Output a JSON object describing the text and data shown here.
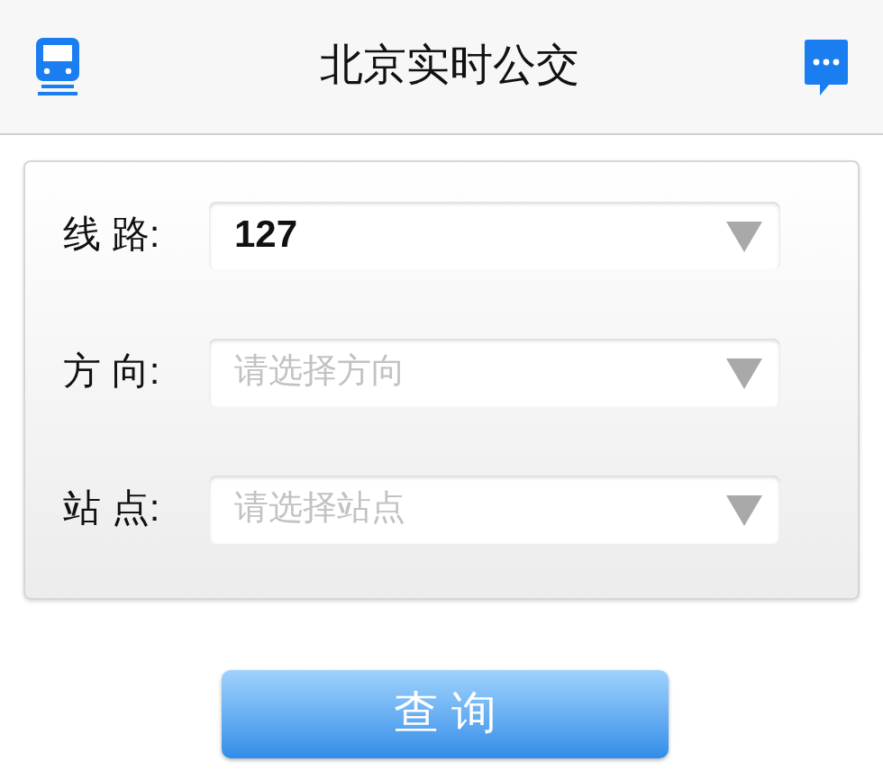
{
  "header": {
    "title": "北京实时公交"
  },
  "form": {
    "rows": [
      {
        "label": "线 路:",
        "value": "127"
      },
      {
        "label": "方 向:",
        "placeholder": "请选择方向"
      },
      {
        "label": "站 点:",
        "placeholder": "请选择站点"
      }
    ]
  },
  "query_button": {
    "label": "查 询"
  }
}
